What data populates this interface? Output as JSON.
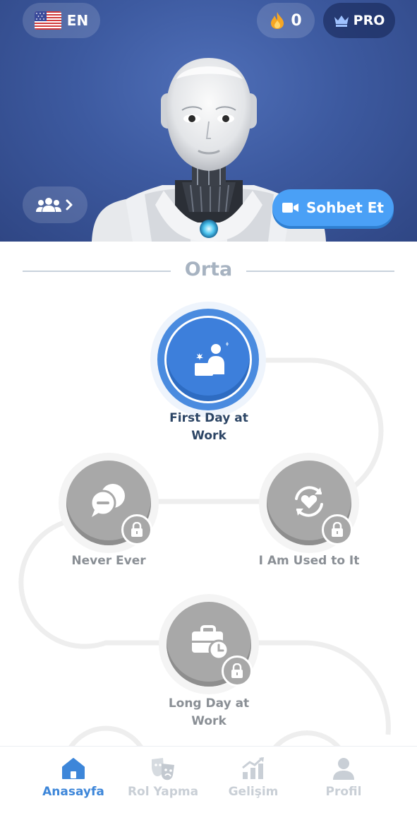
{
  "header": {
    "language": "EN",
    "language_flag": "us-flag-icon",
    "streak_count": "0",
    "pro_label": "PRO",
    "chat_button_label": "Sohbet Et"
  },
  "section": {
    "title": "Orta"
  },
  "lessons": [
    {
      "title_line1": "First Day at",
      "title_line2": "Work",
      "status": "active",
      "icon": "office-desk-icon"
    },
    {
      "title_line1": "Never Ever",
      "title_line2": "",
      "status": "locked",
      "icon": "chat-bubbles-icon"
    },
    {
      "title_line1": "I Am Used to It",
      "title_line2": "",
      "status": "locked",
      "icon": "heart-cycle-icon"
    },
    {
      "title_line1": "Long Day at",
      "title_line2": "Work",
      "status": "locked",
      "icon": "briefcase-clock-icon"
    }
  ],
  "nav": [
    {
      "label": "Anasayfa",
      "icon": "home-icon",
      "active": true
    },
    {
      "label": "Rol Yapma",
      "icon": "theater-masks-icon",
      "active": false
    },
    {
      "label": "Gelişim",
      "icon": "growth-chart-icon",
      "active": false
    },
    {
      "label": "Profil",
      "icon": "profile-icon",
      "active": false
    }
  ],
  "colors": {
    "accent": "#3d86d9",
    "chat_button": "#4aa0f6",
    "locked": "#a8a8a8",
    "hero_bg": "#3d5aa0"
  }
}
